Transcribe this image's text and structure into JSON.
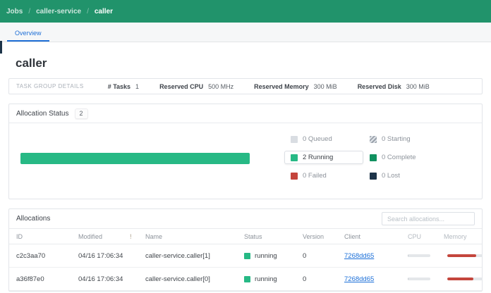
{
  "breadcrumb": {
    "items": [
      "Jobs",
      "caller-service",
      "caller"
    ],
    "separator": "/"
  },
  "tabs": [
    {
      "label": "Overview",
      "active": true
    }
  ],
  "page": {
    "title": "caller"
  },
  "task_group_details": {
    "label": "TASK GROUP DETAILS",
    "stats": [
      {
        "label": "# Tasks",
        "value": "1"
      },
      {
        "label": "Reserved CPU",
        "value": "500 MHz"
      },
      {
        "label": "Reserved Memory",
        "value": "300 MiB"
      },
      {
        "label": "Reserved Disk",
        "value": "300 MiB"
      }
    ]
  },
  "allocation_status": {
    "title": "Allocation Status",
    "count": "2",
    "chart_data": {
      "type": "bar",
      "categories": [
        "Queued",
        "Starting",
        "Running",
        "Complete",
        "Failed",
        "Lost"
      ],
      "values": [
        0,
        0,
        2,
        0,
        0,
        0
      ],
      "title": "Allocation Status",
      "total": 2,
      "legend_position": "right"
    },
    "legend": [
      {
        "label": "0 Queued",
        "count": 0,
        "color": "#d9dde2",
        "style": "solid",
        "highlight": false
      },
      {
        "label": "2 Running",
        "count": 2,
        "color": "#27b985",
        "style": "solid",
        "highlight": true
      },
      {
        "label": "0 Failed",
        "count": 0,
        "color": "#c4443c",
        "style": "solid",
        "highlight": false
      },
      {
        "label": "0 Starting",
        "count": 0,
        "color": "#9aa2ab",
        "style": "striped",
        "highlight": false
      },
      {
        "label": "0 Complete",
        "count": 0,
        "color": "#119160",
        "style": "solid",
        "highlight": false
      },
      {
        "label": "0 Lost",
        "count": 0,
        "color": "#1d3449",
        "style": "solid",
        "highlight": false
      }
    ]
  },
  "allocations": {
    "title": "Allocations",
    "search_placeholder": "Search allocations...",
    "columns": [
      "ID",
      "Modified",
      "!",
      "Name",
      "Status",
      "Version",
      "Client",
      "CPU",
      "Memory"
    ],
    "rows": [
      {
        "id": "c2c3aa70",
        "modified": "04/16 17:06:34",
        "reschedule": "",
        "name": "caller-service.caller[1]",
        "status": "running",
        "version": "0",
        "client": "7268dd65",
        "cpu_pct": 3,
        "memory_pct": 82
      },
      {
        "id": "a36f87e0",
        "modified": "04/16 17:06:34",
        "reschedule": "",
        "name": "caller-service.caller[0]",
        "status": "running",
        "version": "0",
        "client": "7268dd65",
        "cpu_pct": 3,
        "memory_pct": 74
      }
    ]
  },
  "colors": {
    "header_green": "#21936b",
    "accent_green": "#27b985",
    "complete_green": "#119160",
    "failed_red": "#c4443c",
    "lost_navy": "#1d3449",
    "queued_gray": "#d9dde2",
    "tab_blue": "#1f6fd6",
    "link_blue": "#1b6fd8",
    "memory_red": "#c4463c",
    "cpu_gray": "#c7ccd1"
  }
}
